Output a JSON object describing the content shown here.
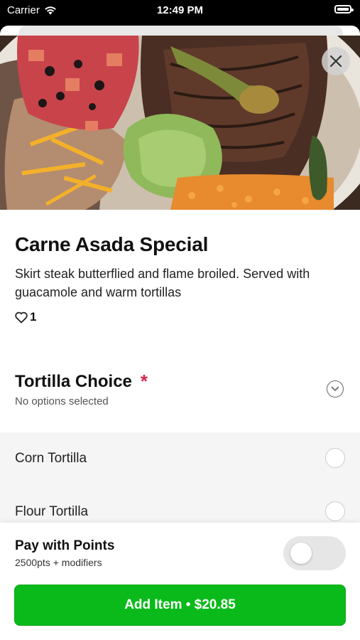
{
  "status_bar": {
    "carrier": "Carrier",
    "time": "12:49 PM"
  },
  "item": {
    "title": "Carne Asada Special",
    "description": "Skirt steak butterflied and flame broiled. Served with guacamole and warm tortillas",
    "likes": "1",
    "image_icon": "food-photo"
  },
  "modifier_group": {
    "title": "Tortilla Choice",
    "required_mark": "*",
    "status": "No options selected",
    "options": [
      {
        "label": "Corn Tortilla",
        "selected": false
      },
      {
        "label": "Flour Tortilla",
        "selected": false
      }
    ]
  },
  "footer": {
    "points_title": "Pay with Points",
    "points_subtitle": "2500pts + modifiers",
    "points_toggle_on": false,
    "add_button_label": "Add Item • $20.85"
  },
  "colors": {
    "accent": "#0aba1a",
    "required": "#d4264e"
  }
}
